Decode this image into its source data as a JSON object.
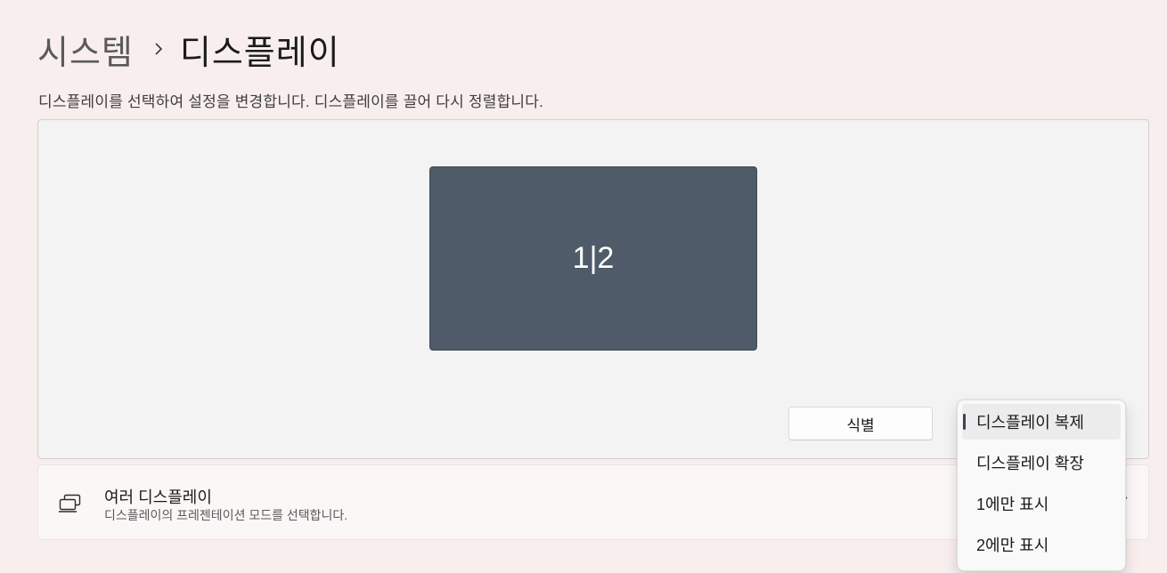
{
  "breadcrumb": {
    "parent": "시스템",
    "current": "디스플레이"
  },
  "description": "디스플레이를 선택하여 설정을 변경합니다. 디스플레이를 끌어 다시 정렬합니다.",
  "arrangement": {
    "monitor_label": "1|2",
    "identify_label": "식별"
  },
  "multi_display": {
    "title": "여러 디스플레이",
    "subtitle": "디스플레이의 프레젠테이션 모드를 선택합니다."
  },
  "dropdown": {
    "options": [
      {
        "label": "디스플레이 복제",
        "selected": true
      },
      {
        "label": "디스플레이 확장",
        "selected": false
      },
      {
        "label": "1에만 표시",
        "selected": false
      },
      {
        "label": "2에만 표시",
        "selected": false
      }
    ]
  },
  "colors": {
    "background": "#f9eeee",
    "monitor_tile": "#505b69",
    "accent_indicator": "#3a4452"
  },
  "icons": {
    "multi_display": "multiple-displays-icon",
    "chevron": "chevron-down-icon",
    "breadcrumb_separator": "chevron-right-icon"
  }
}
